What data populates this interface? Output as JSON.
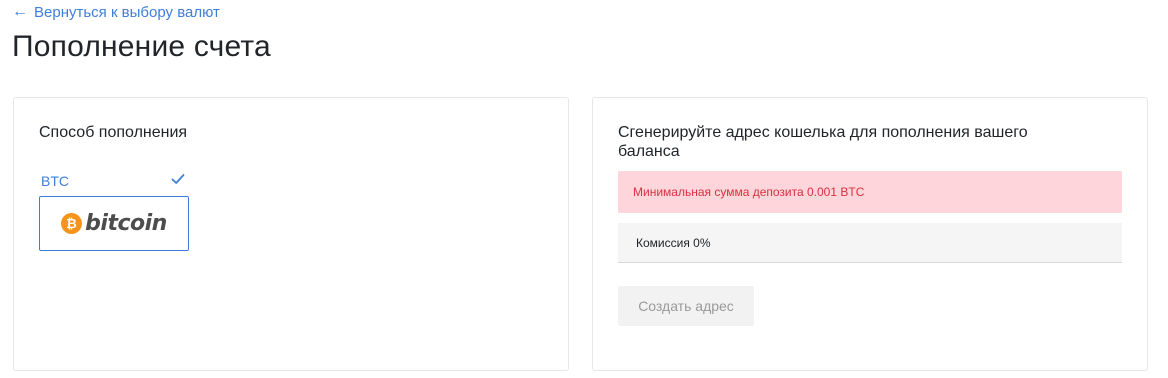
{
  "nav": {
    "back_arrow": "←",
    "back_label": "Вернуться к выбору валют"
  },
  "page": {
    "title": "Пополнение счета"
  },
  "method_panel": {
    "heading": "Способ пополнения",
    "selected_method": {
      "code": "BTC",
      "logo_text": "bitcoin",
      "selected": true,
      "icon": "check-icon"
    }
  },
  "deposit_panel": {
    "heading": "Сгенерируйте адрес кошелька для пополнения вашего баланса",
    "min_deposit_alert": "Минимальная сумма депозита 0.001 BTC",
    "fee_text": "Комиссия 0%",
    "create_address_button": "Создать адрес"
  },
  "colors": {
    "accent": "#3f7fd8",
    "alert_bg": "#fdd5db",
    "alert_text": "#d6323f",
    "bitcoin_orange": "#f7931a"
  }
}
